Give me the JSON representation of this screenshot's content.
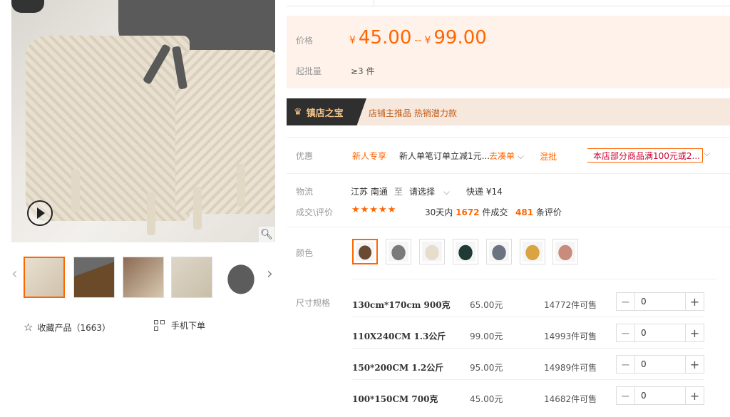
{
  "gallery": {
    "thumbnail_count": 5
  },
  "actions": {
    "favorite_label": "收藏产品（1663）",
    "mobile_order_label": "手机下单"
  },
  "price": {
    "label": "价格",
    "currency": "¥",
    "min": "45.00",
    "separator": "--",
    "max": "99.00",
    "moq_label": "起批量",
    "moq_value": "≥3 件"
  },
  "shop": {
    "badge": "镇店之宝",
    "tagline": "店铺主推品  热销潜力款"
  },
  "promo": {
    "label": "优惠",
    "newcomer": "新人专享",
    "desc": "新人单笔订单立减1元...",
    "cart_link": "去凑单",
    "mix": "混批",
    "banner": "本店部分商品满100元或2..."
  },
  "shipping": {
    "label": "物流",
    "from": "江苏 南通",
    "to_sep": "至",
    "select": "请选择",
    "method": "快递 ¥14"
  },
  "deal": {
    "label": "成交\\评价",
    "stars": "★★★★★",
    "stats_prefix": "30天内",
    "sold_count": "1672",
    "stats_suffix": "件成交",
    "review_count": "481",
    "review_suffix": "条评价"
  },
  "colors": {
    "label": "颜色",
    "swatches": [
      "#6b4a34",
      "#7a7a7a",
      "#e6ddcc",
      "#1f3a35",
      "#6b7280",
      "#d9a441",
      "#c98b7b"
    ]
  },
  "sizes": {
    "label": "尺寸规格",
    "rows": [
      {
        "name": "130cm*170cm 900克",
        "price": "65.00元",
        "stock": "14772件可售",
        "qty": "0"
      },
      {
        "name": "110X240CM 1.3公斤",
        "price": "99.00元",
        "stock": "14993件可售",
        "qty": "0"
      },
      {
        "name": "150*200CM 1.2公斤",
        "price": "95.00元",
        "stock": "14989件可售",
        "qty": "0"
      },
      {
        "name": "100*150CM 700克",
        "price": "45.00元",
        "stock": "14682件可售",
        "qty": "0"
      }
    ]
  },
  "theme": {
    "accent": "#ff6600"
  }
}
